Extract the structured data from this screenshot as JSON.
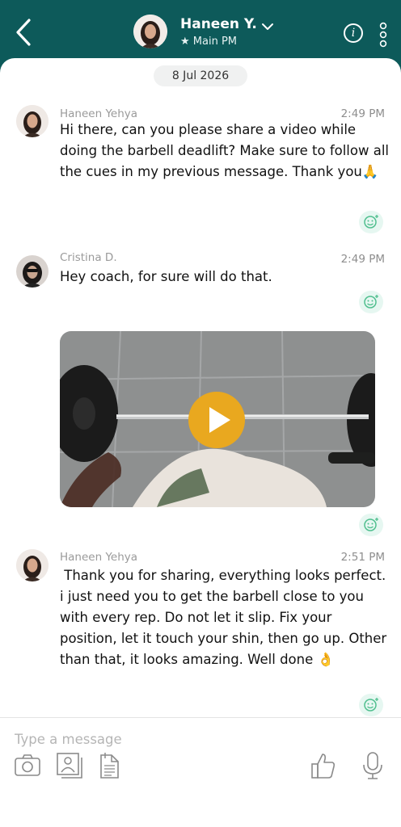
{
  "header": {
    "name": "Haneen Y.",
    "subtitle": "★ Main PM"
  },
  "chat": {
    "date": "8 Jul 2026",
    "messages": [
      {
        "sender": "Haneen Yehya",
        "time": "2:49 PM",
        "text": "Hi there, can you please share a video while doing the barbell deadlift? Make sure to follow all the cues in my previous message. Thank you🙏"
      },
      {
        "sender": "Cristina D.",
        "time": "2:49 PM",
        "text": "Hey coach, for sure will do that.",
        "attachment": "video"
      },
      {
        "sender": "Haneen Yehya",
        "time": "2:51 PM",
        "text": " Thank you for sharing, everything looks perfect. i just need you to get the barbell close to you with every rep. Do not let it slip. Fix your position, let it touch your shin, then go up. Other than that, it looks amazing. Well done 👌"
      }
    ]
  },
  "composer": {
    "placeholder": "Type a message",
    "value": ""
  },
  "icons": {
    "back": "chevron-left-icon",
    "dropdown": "chevron-down-icon",
    "info": "info-icon",
    "more": "more-vertical-icon",
    "reaction": "add-reaction-icon",
    "play": "play-icon",
    "camera": "camera-icon",
    "contact": "contact-card-icon",
    "document": "document-icon",
    "thumbs_up": "thumbs-up-icon",
    "microphone": "microphone-icon"
  },
  "colors": {
    "header": "#0d5a5a",
    "reaction_bg": "#e6f7f1",
    "reaction_icon": "#4fbf8e",
    "play_button": "#e9a81f",
    "muted_text": "#9a9a9a"
  }
}
